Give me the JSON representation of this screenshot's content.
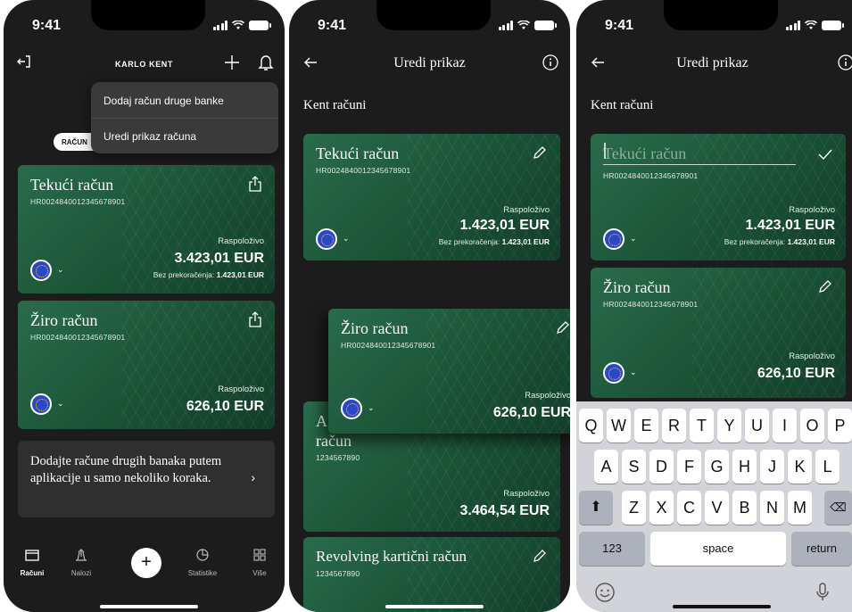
{
  "status": {
    "time": "9:41"
  },
  "screen1": {
    "title": "KARLO KENT",
    "menu": [
      "Dodaj račun druge banke",
      "Uredi prikaz računa"
    ],
    "tab_pill": "RAČUN",
    "accounts": [
      {
        "name": "Tekući račun",
        "iban": "HR0024840012345678901",
        "available_label": "Raspoloživo",
        "amount": "3.423,01 EUR",
        "overdraft_label": "Bez prekoračenja:",
        "overdraft_amount": "1.423,01 EUR"
      },
      {
        "name": "Žiro račun",
        "iban": "HR0024840012345678901",
        "available_label": "Raspoloživo",
        "amount": "626,10 EUR"
      }
    ],
    "promo": {
      "text": "Dodajte račune drugih banaka putem aplikacije u samo nekoliko koraka.",
      "arrow": "›"
    },
    "tabs": [
      {
        "label": "Računi",
        "icon": "wallet-icon",
        "active": true
      },
      {
        "label": "Nalozi",
        "icon": "transfer-icon",
        "active": false
      },
      {
        "label": "+",
        "icon": "plus-icon",
        "active": false
      },
      {
        "label": "Statistike",
        "icon": "pie-chart-icon",
        "active": false
      },
      {
        "label": "Više",
        "icon": "grid-icon",
        "active": false
      }
    ]
  },
  "screen2": {
    "title": "Uredi prikaz",
    "section": "Kent računi",
    "accounts": [
      {
        "name": "Tekući račun",
        "iban": "HR0024840012345678901",
        "available_label": "Raspoloživo",
        "amount": "1.423,01 EUR",
        "overdraft_label": "Bez prekoračenja:",
        "overdraft_amount": "1.423,01 EUR"
      },
      {
        "name": "Žiro račun",
        "iban": "HR0024840012345678901",
        "available_label": "Raspoloživo",
        "amount": "626,10 EUR"
      },
      {
        "name_line1": "A",
        "name_line2": "račun",
        "iban": "1234567890",
        "available_label": "Raspoloživo",
        "amount": "3.464,54 EUR"
      },
      {
        "name": "Revolving kartični račun",
        "iban": "1234567890"
      }
    ]
  },
  "screen3": {
    "title": "Uredi prikaz",
    "section": "Kent računi",
    "edit_placeholder": "Tekući račun",
    "accounts": [
      {
        "iban": "HR0024840012345678901",
        "available_label": "Raspoloživo",
        "amount": "1.423,01 EUR",
        "overdraft_label": "Bez prekoračenja:",
        "overdraft_amount": "1.423,01 EUR"
      },
      {
        "name": "Žiro račun",
        "iban": "HR0024840012345678901",
        "available_label": "Raspoloživo",
        "amount": "626,10 EUR"
      }
    ],
    "keyboard": {
      "row1": [
        "Q",
        "W",
        "E",
        "R",
        "T",
        "Y",
        "U",
        "I",
        "O",
        "P"
      ],
      "row2": [
        "A",
        "S",
        "D",
        "F",
        "G",
        "H",
        "J",
        "K",
        "L"
      ],
      "row3": [
        "Z",
        "X",
        "C",
        "V",
        "B",
        "N",
        "M"
      ],
      "numbers": "123",
      "space": "space",
      "return": "return"
    }
  },
  "colors": {
    "card_green": "#1a5236",
    "background": "#1c1c1c",
    "eu_blue": "#2a47c7"
  }
}
